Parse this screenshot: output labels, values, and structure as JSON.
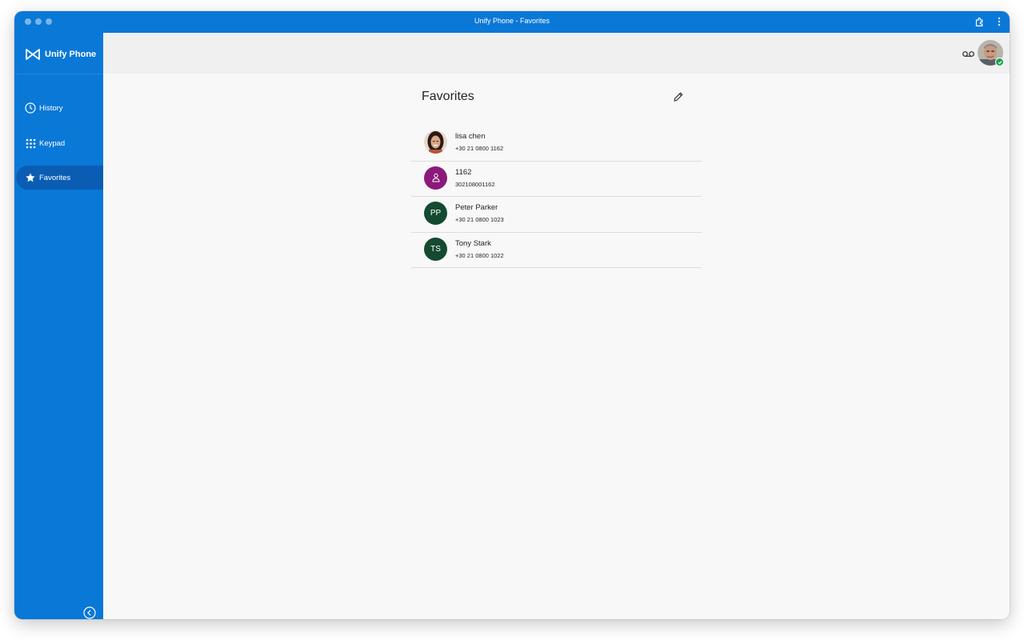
{
  "window": {
    "title": "Unify Phone - Favorites"
  },
  "brand": {
    "name": "Unify Phone"
  },
  "sidebar": {
    "items": [
      {
        "label": "History",
        "icon": "clock-icon"
      },
      {
        "label": "Keypad",
        "icon": "keypad-icon"
      },
      {
        "label": "Favorites",
        "icon": "star-icon",
        "active": true
      }
    ]
  },
  "header": {
    "user_presence": "available"
  },
  "main": {
    "title": "Favorites",
    "favorites": [
      {
        "name": "lisa chen",
        "number": "+30 21 0800 1162",
        "avatar": "photo"
      },
      {
        "name": "1162",
        "number": "302108001162",
        "avatar": "person-icon"
      },
      {
        "name": "Peter Parker",
        "number": "+30 21 0800 1023",
        "initials": "PP"
      },
      {
        "name": "Tony Stark",
        "number": "+30 21 0800 1022",
        "initials": "TS"
      }
    ]
  },
  "colors": {
    "brand_blue": "#0a78d7",
    "active_nav": "#0a5db3",
    "avatar_purple": "#8b1a7a",
    "avatar_green": "#144a2f",
    "presence_green": "#16a34a"
  }
}
